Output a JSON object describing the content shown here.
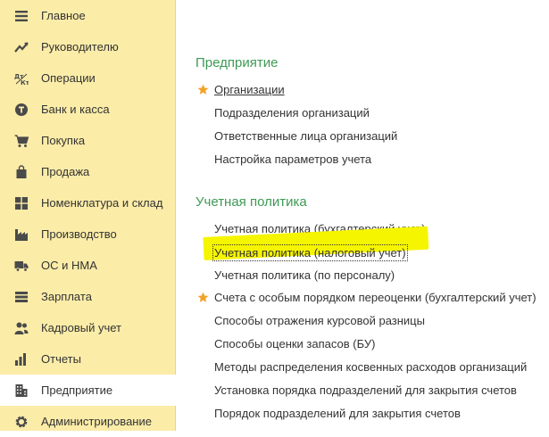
{
  "sidebar": {
    "items": [
      {
        "label": "Главное",
        "icon": "menu-icon"
      },
      {
        "label": "Руководителю",
        "icon": "trend-chart-icon"
      },
      {
        "label": "Операции",
        "icon": "debit-credit-icon"
      },
      {
        "label": "Банк и касса",
        "icon": "coin-icon"
      },
      {
        "label": "Покупка",
        "icon": "cart-icon"
      },
      {
        "label": "Продажа",
        "icon": "shopping-bag-icon"
      },
      {
        "label": "Номенклатура и склад",
        "icon": "grid-icon"
      },
      {
        "label": "Производство",
        "icon": "factory-icon"
      },
      {
        "label": "ОС и НМА",
        "icon": "truck-icon"
      },
      {
        "label": "Зарплата",
        "icon": "wallet-icon"
      },
      {
        "label": "Кадровый учет",
        "icon": "people-icon"
      },
      {
        "label": "Отчеты",
        "icon": "bar-chart-icon"
      },
      {
        "label": "Предприятие",
        "icon": "building-icon"
      },
      {
        "label": "Администрирование",
        "icon": "gear-icon"
      }
    ],
    "active_index": 12
  },
  "main": {
    "sections": [
      {
        "title": "Предприятие",
        "links": [
          {
            "label": "Организации",
            "starred": true
          },
          {
            "label": "Подразделения организаций"
          },
          {
            "label": "Ответственные лица организаций"
          },
          {
            "label": "Настройка параметров учета"
          }
        ]
      },
      {
        "title": "Учетная политика",
        "links": [
          {
            "label": "Учетная политика (бухгалтерский учет)"
          },
          {
            "label": "Учетная политика (налоговый учет)",
            "highlighted": true
          },
          {
            "label": "Учетная политика (по персоналу)"
          },
          {
            "label": "Счета с особым порядком переоценки (бухгалтерский учет)",
            "starred": true
          },
          {
            "label": "Способы отражения курсовой разницы"
          },
          {
            "label": "Способы оценки запасов (БУ)"
          },
          {
            "label": "Методы распределения косвенных расходов организаций"
          },
          {
            "label": "Установка порядка подразделений для закрытия счетов"
          },
          {
            "label": "Порядок подразделений для закрытия счетов"
          }
        ]
      }
    ]
  },
  "colors": {
    "sidebar_bg": "#fbeca8",
    "section_title": "#3d9a54",
    "star": "#f2a32a",
    "highlighter": "#f6f500",
    "icon": "#4a4a4a"
  }
}
